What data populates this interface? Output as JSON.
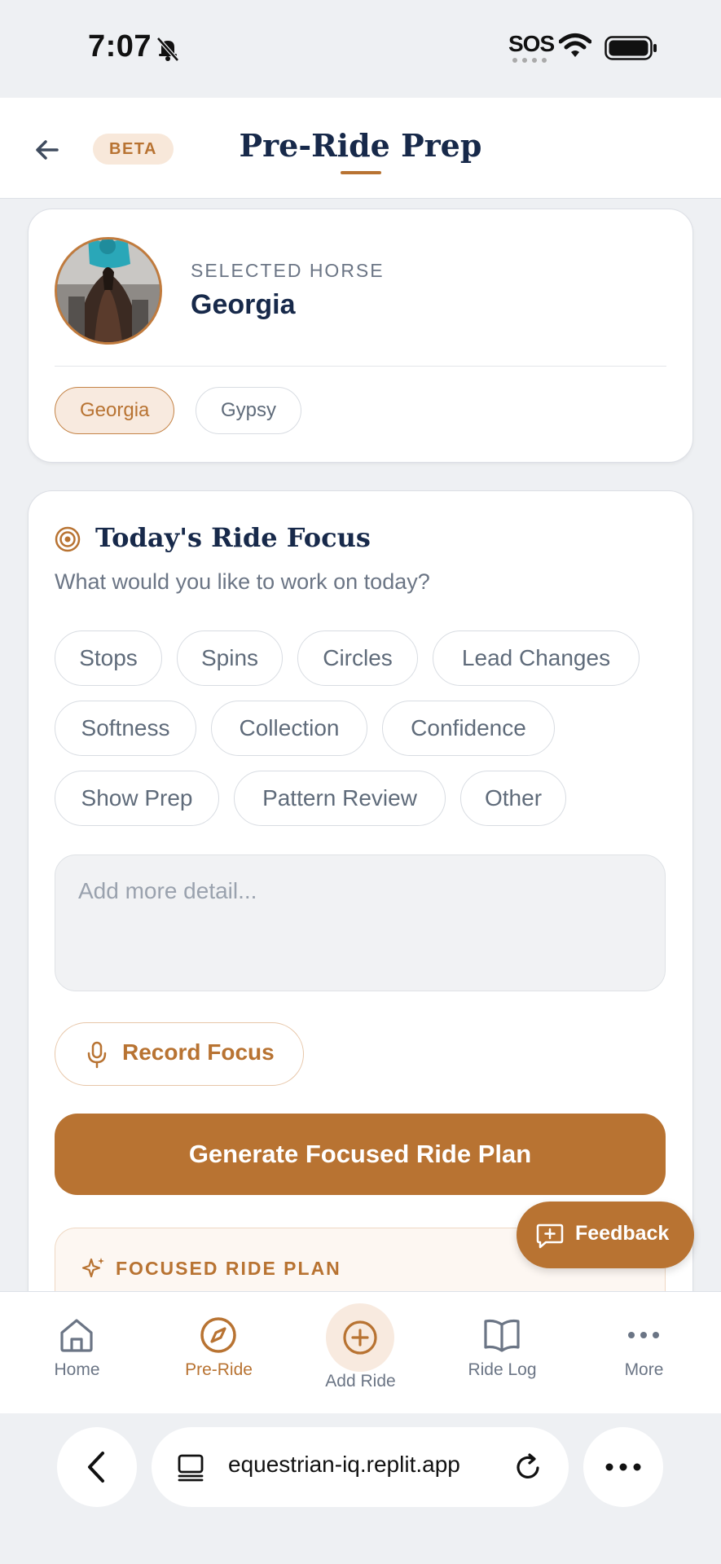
{
  "status_bar": {
    "time": "7:07",
    "sos": "SOS"
  },
  "header": {
    "badge": "BETA",
    "title": "Pre-Ride Prep"
  },
  "horse_card": {
    "label": "SELECTED HORSE",
    "name": "Georgia",
    "horses": [
      {
        "label": "Georgia",
        "active": true
      },
      {
        "label": "Gypsy",
        "active": false
      }
    ]
  },
  "focus_card": {
    "title": "Today's Ride Focus",
    "subtitle": "What would you like to work on today?",
    "chips": [
      "Stops",
      "Spins",
      "Circles",
      "Lead Changes",
      "Softness",
      "Collection",
      "Confidence",
      "Show Prep",
      "Pattern Review",
      "Other"
    ],
    "detail_placeholder": "Add more detail...",
    "record_label": "Record Focus",
    "generate_label": "Generate Focused Ride Plan",
    "plan_label": "FOCUSED RIDE PLAN"
  },
  "feedback": {
    "label": "Feedback"
  },
  "bottom_nav": {
    "items": [
      {
        "label": "Home",
        "icon": "home-icon",
        "active": false
      },
      {
        "label": "Pre-Ride",
        "icon": "compass-icon",
        "active": true
      },
      {
        "label": "Add Ride",
        "icon": "plus-circle-icon",
        "active": false
      },
      {
        "label": "Ride Log",
        "icon": "book-icon",
        "active": false
      },
      {
        "label": "More",
        "icon": "more-dots-icon",
        "active": false
      }
    ]
  },
  "browser": {
    "url": "equestrian-iq.replit.app"
  },
  "colors": {
    "accent": "#b87332",
    "navy": "#17294a",
    "muted": "#6b7585"
  }
}
